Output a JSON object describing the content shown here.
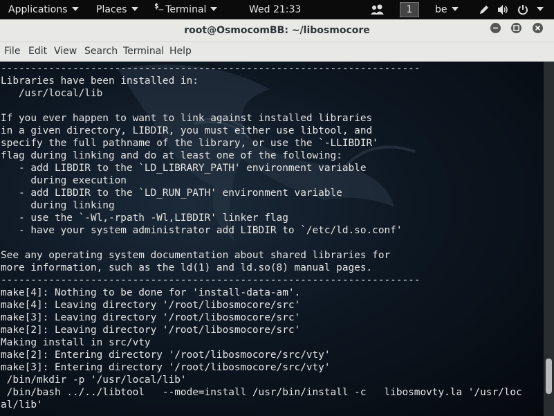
{
  "topbar": {
    "applications": "Applications",
    "places": "Places",
    "terminal_icon_text": "$_",
    "terminal": "Terminal",
    "clock": "Wed 21:33",
    "workspace": "1",
    "keyboard_layout": "be"
  },
  "window": {
    "title": "root@OsmocomBB: ~/libosmocore"
  },
  "menu": {
    "items": [
      "File",
      "Edit",
      "View",
      "Search",
      "Terminal",
      "Help"
    ]
  },
  "terminal": {
    "lines": [
      "----------------------------------------------------------------------",
      "Libraries have been installed in:",
      "   /usr/local/lib",
      "",
      "If you ever happen to want to link against installed libraries",
      "in a given directory, LIBDIR, you must either use libtool, and",
      "specify the full pathname of the library, or use the `-LLIBDIR'",
      "flag during linking and do at least one of the following:",
      "   - add LIBDIR to the `LD_LIBRARY_PATH' environment variable",
      "     during execution",
      "   - add LIBDIR to the `LD_RUN_PATH' environment variable",
      "     during linking",
      "   - use the `-Wl,-rpath -Wl,LIBDIR' linker flag",
      "   - have your system administrator add LIBDIR to `/etc/ld.so.conf'",
      "",
      "See any operating system documentation about shared libraries for",
      "more information, such as the ld(1) and ld.so(8) manual pages.",
      "----------------------------------------------------------------------",
      "make[4]: Nothing to be done for 'install-data-am'.",
      "make[4]: Leaving directory '/root/libosmocore/src'",
      "make[3]: Leaving directory '/root/libosmocore/src'",
      "make[2]: Leaving directory '/root/libosmocore/src'",
      "Making install in src/vty",
      "make[2]: Entering directory '/root/libosmocore/src/vty'",
      "make[3]: Entering directory '/root/libosmocore/src/vty'",
      " /bin/mkdir -p '/usr/local/lib'",
      " /bin/bash ../../libtool   --mode=install /usr/bin/install -c   libosmovty.la '/usr/loc",
      "al/lib'"
    ]
  },
  "scrollbar": {
    "position_fraction": 0.93,
    "visible_fraction": 0.1
  },
  "colors": {
    "panel": "#0b0b0b",
    "titlebar": "#e8e8e7",
    "terminal_text": "#e6e6e6",
    "terminal_bg": "#0d1722"
  }
}
